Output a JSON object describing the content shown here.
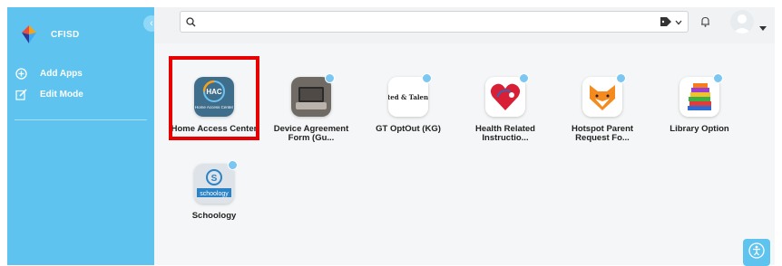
{
  "sidebar": {
    "brand": "CFISD",
    "items": [
      {
        "label": "Add Apps",
        "icon": "plus-circle-icon"
      },
      {
        "label": "Edit Mode",
        "icon": "edit-icon"
      }
    ],
    "collapse_icon": "chevron-left-icon"
  },
  "topbar": {
    "search": {
      "value": "",
      "placeholder": ""
    },
    "icons": [
      "search-icon",
      "tag-icon",
      "chevron-down-icon",
      "bell-icon",
      "avatar-icon",
      "caret-down-icon"
    ]
  },
  "apps": [
    {
      "name": "Home Access Center",
      "icon_text": "HAC",
      "icon_sub": "Home Access Center",
      "highlighted": true
    },
    {
      "name": "Device Agreement Form (Gu...",
      "icon": "laptop-icon"
    },
    {
      "name": "GT OptOut (KG)",
      "icon_text": "Gifted & Talented"
    },
    {
      "name": "Health Related Instructio...",
      "icon": "heart-icon"
    },
    {
      "name": "Hotspot Parent Request Fo...",
      "icon": "fox-icon"
    },
    {
      "name": "Library Option",
      "icon": "books-icon"
    },
    {
      "name": "Schoology",
      "icon_text": "schoology",
      "icon_letter": "S"
    }
  ],
  "colors": {
    "sidebar": "#5ec4ef",
    "highlight": "#e60000",
    "accent_dot": "#7cc6f2"
  }
}
